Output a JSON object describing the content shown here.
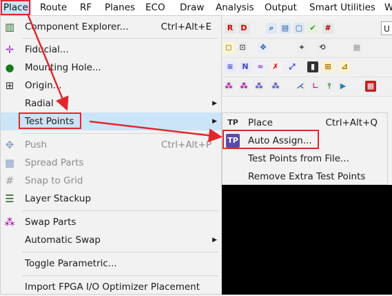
{
  "menubar": {
    "items": [
      "Place",
      "Route",
      "RF",
      "Planes",
      "ECO",
      "Draw",
      "Analysis",
      "Output",
      "Smart Utilities",
      "W"
    ]
  },
  "toolbar": {
    "units_field": "U"
  },
  "place_menu": {
    "items": [
      {
        "label": "Component Explorer...",
        "shortcut": "Ctrl+Alt+E",
        "icon": "component-explorer-icon"
      },
      {
        "label": "Fiducial...",
        "icon": "fiducial-icon"
      },
      {
        "label": "Mounting Hole...",
        "icon": "mounting-hole-icon"
      },
      {
        "label": "Origin...",
        "icon": "origin-icon"
      },
      {
        "label": "Radial",
        "submenu": true
      },
      {
        "label": "Test Points",
        "submenu": true,
        "highlighted": true
      },
      {
        "label": "Push",
        "shortcut": "Ctrl+Alt+P",
        "disabled": true,
        "icon": "push-icon"
      },
      {
        "label": "Spread Parts",
        "disabled": true,
        "icon": "spread-parts-icon"
      },
      {
        "label": "Snap to Grid",
        "disabled": true,
        "icon": "snap-grid-icon"
      },
      {
        "label": "Layer Stackup",
        "icon": "layer-stackup-icon"
      },
      {
        "label": "Swap Parts",
        "icon": "swap-parts-icon"
      },
      {
        "label": "Automatic Swap",
        "submenu": true
      },
      {
        "label": "Toggle Parametric..."
      },
      {
        "label": "Import FPGA I/O Optimizer Placement"
      }
    ]
  },
  "test_points_submenu": {
    "items": [
      {
        "label": "Place",
        "shortcut": "Ctrl+Alt+Q",
        "icon": "place-testpoint-icon"
      },
      {
        "label": "Auto Assign...",
        "icon": "auto-assign-icon"
      },
      {
        "label": "Test Points from File..."
      },
      {
        "label": "Remove Extra Test Points"
      }
    ]
  },
  "colors": {
    "highlight": "#cce4f7",
    "annotation_red": "#e2262d"
  }
}
